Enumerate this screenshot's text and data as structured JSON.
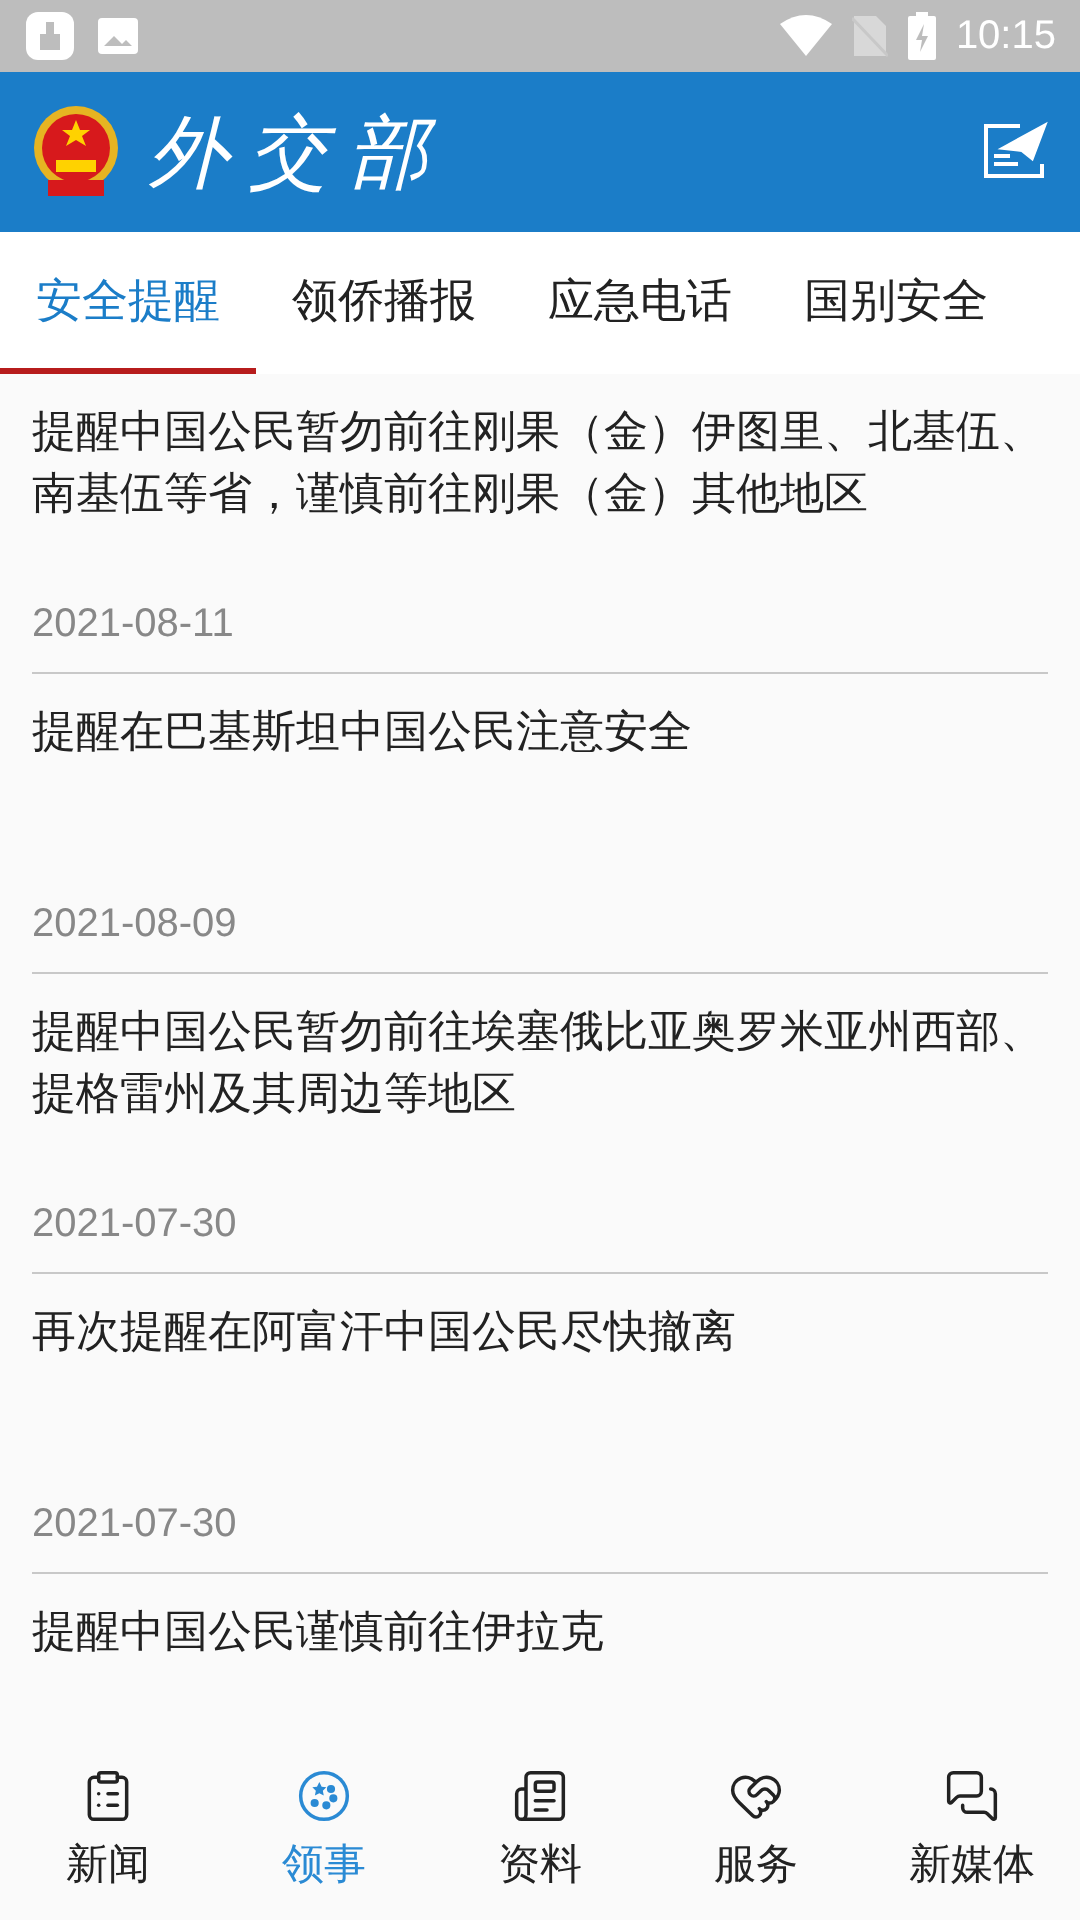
{
  "status_bar": {
    "time": "10:15"
  },
  "header": {
    "logo_text": "外交部"
  },
  "tabs": [
    {
      "label": "安全提醒",
      "selected": true
    },
    {
      "label": "领侨播报",
      "selected": false
    },
    {
      "label": "应急电话",
      "selected": false
    },
    {
      "label": "国别安全",
      "selected": false
    }
  ],
  "articles": [
    {
      "title": "提醒中国公民暂勿前往刚果（金）伊图里、北基伍、南基伍等省，谨慎前往刚果（金）其他地区",
      "date": "2021-08-11"
    },
    {
      "title": "提醒在巴基斯坦中国公民注意安全",
      "date": "2021-08-09"
    },
    {
      "title": "提醒中国公民暂勿前往埃塞俄比亚奥罗米亚州西部、提格雷州及其周边等地区",
      "date": "2021-07-30"
    },
    {
      "title": "再次提醒在阿富汗中国公民尽快撤离",
      "date": "2021-07-30"
    },
    {
      "title": "提醒中国公民谨慎前往伊拉克"
    }
  ],
  "bottom_nav": [
    {
      "label": "新闻",
      "kind": "clipboard",
      "selected": false
    },
    {
      "label": "领事",
      "kind": "stars",
      "selected": true
    },
    {
      "label": "资料",
      "kind": "newspaper",
      "selected": false
    },
    {
      "label": "服务",
      "kind": "handshake",
      "selected": false
    },
    {
      "label": "新媒体",
      "kind": "chat",
      "selected": false
    }
  ]
}
